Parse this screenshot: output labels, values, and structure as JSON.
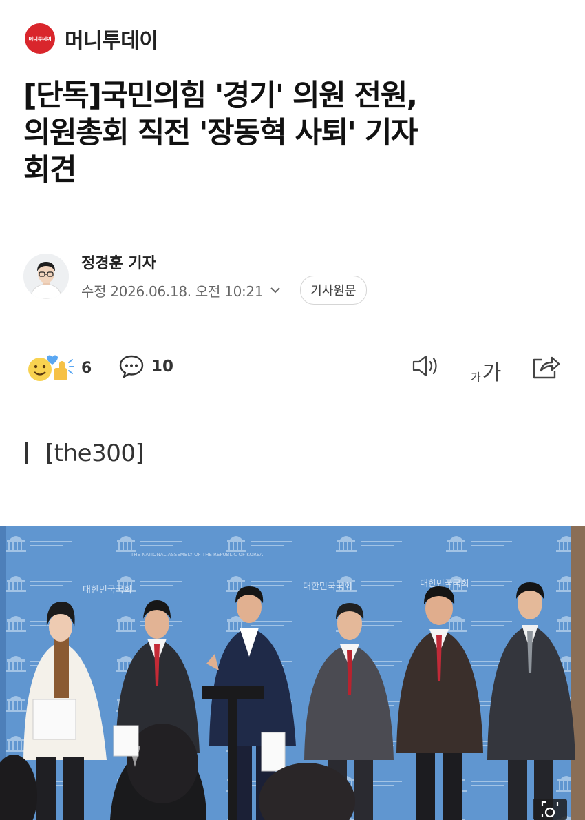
{
  "header": {
    "logo_text": "머니투데이",
    "brand": "머니투데이",
    "brand_color": "#d9262c"
  },
  "article": {
    "headline_lines": [
      "[단독]국민의힘 '경기' 의원 전원,",
      "의원총회 직전 '장동혁 사퇴' 기자",
      "회견"
    ],
    "reporter": "정경훈 기자",
    "date": "수정 2026.06.18. 오전 10:21",
    "original_button": "기사원문",
    "section_label": "[the300]"
  },
  "actions": {
    "reaction_count": "6",
    "comment_count": "10",
    "font_small": "가",
    "font_big": "가",
    "icons": [
      "reaction-emoji-icon",
      "comment-bubble-icon",
      "speaker-icon",
      "font-size-icon",
      "share-icon",
      "expand-icon"
    ]
  },
  "photo": {
    "backdrop_text": "대한민국국회",
    "backdrop_subtext": "THE NATIONAL ASSEMBLY OF THE REPUBLIC OF KOREA",
    "backdrop_color": "#5f93ce"
  }
}
